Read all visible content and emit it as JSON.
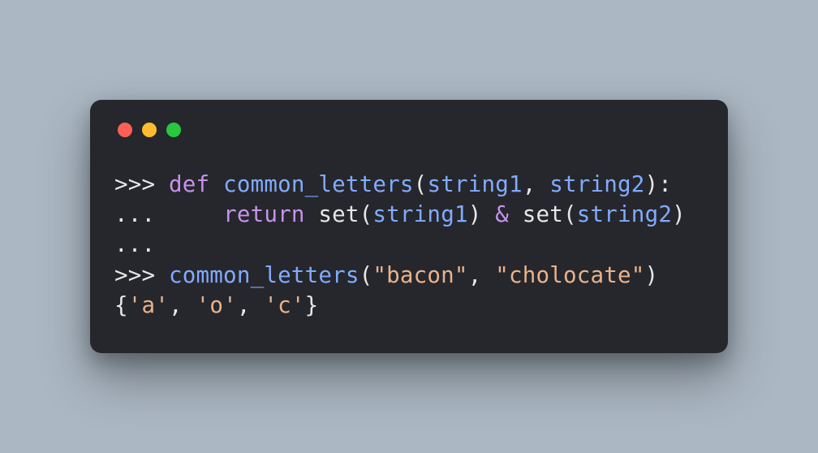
{
  "traffic": {
    "red": "#ff5f57",
    "yellow": "#febc2e",
    "green": "#28c840"
  },
  "code": {
    "p1": ">>> ",
    "kw_def": "def",
    "sp": " ",
    "fn": "common_letters",
    "lp": "(",
    "param1": "string1",
    "comma": ", ",
    "param2": "string2",
    "rp_colon": "):",
    "p2": "...     ",
    "kw_return": "return",
    "set1_open": "set(",
    "arg1": "string1",
    "rp": ")",
    "amp_op": " & ",
    "set2_open": "set(",
    "arg2": "string2",
    "p3": "...",
    "p4": ">>> ",
    "call_fn": "common_letters",
    "call_lp": "(",
    "str1": "\"bacon\"",
    "call_comma": ", ",
    "str2": "\"cholocate\"",
    "call_rp": ")",
    "out_lb": "{",
    "out_a": "'a'",
    "out_c1": ", ",
    "out_o": "'o'",
    "out_c2": ", ",
    "out_c": "'c'",
    "out_rb": "}"
  }
}
